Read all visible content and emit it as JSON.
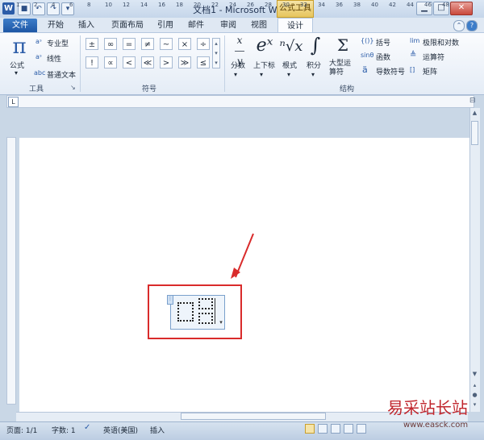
{
  "window": {
    "title": "文档1 - Microsoft Word",
    "app_icon": "W",
    "contextual_tab": "公式工具"
  },
  "qat": {
    "undo": "↶",
    "redo": "↷",
    "save": "■",
    "customize": "▾"
  },
  "window_controls": {
    "min": "▁",
    "max": "□",
    "close": "✕"
  },
  "tabs": [
    {
      "label": "文件"
    },
    {
      "label": "开始"
    },
    {
      "label": "插入"
    },
    {
      "label": "页面布局"
    },
    {
      "label": "引用"
    },
    {
      "label": "邮件"
    },
    {
      "label": "审阅"
    },
    {
      "label": "视图"
    },
    {
      "label": "设计"
    }
  ],
  "ribbon": {
    "tools": {
      "label": "工具",
      "equation": {
        "symbol": "π",
        "label": "公式"
      },
      "options": [
        "专业型",
        "线性",
        "普通文本"
      ],
      "option_icons": [
        "aˢ",
        "aˢ",
        "abc"
      ]
    },
    "symbols": {
      "label": "符号",
      "row1": [
        "±",
        "∞",
        "=",
        "≠",
        "~",
        "×",
        "÷"
      ],
      "row2": [
        "!",
        "∝",
        "<",
        "≪",
        ">",
        "≫",
        "≤"
      ]
    },
    "structures": {
      "label": "结构",
      "items": [
        {
          "label": "分数",
          "glyph": "x/y"
        },
        {
          "label": "上下标",
          "glyph": "eˣ"
        },
        {
          "label": "根式",
          "glyph": "ⁿ√x"
        },
        {
          "label": "积分",
          "glyph": "∫"
        },
        {
          "label": "大型运算符",
          "glyph": "Σ"
        }
      ],
      "small": [
        "括号",
        "函数",
        "导数符号",
        "极限和对数",
        "运算符",
        "矩阵"
      ],
      "small_icons": [
        "{()}",
        "sinθ",
        "ä",
        "lim",
        "≜",
        "[]"
      ]
    }
  },
  "ruler": {
    "marks": [
      "1",
      "2",
      "4",
      "6",
      "8",
      "10",
      "12",
      "14",
      "16",
      "18",
      "20",
      "22",
      "24",
      "26",
      "28",
      "30",
      "32",
      "34",
      "36",
      "38",
      "40",
      "42",
      "44",
      "46",
      "48"
    ]
  },
  "status": {
    "page": "页面: 1/1",
    "words": "字数: 1",
    "language": "英语(美国)",
    "mode": "插入"
  },
  "watermark": {
    "text": "易采站长站",
    "url": "www.easck.com"
  },
  "colors": {
    "accent": "#1d56a5",
    "highlight": "#d92b2b",
    "contextual": "#e6c55c"
  }
}
